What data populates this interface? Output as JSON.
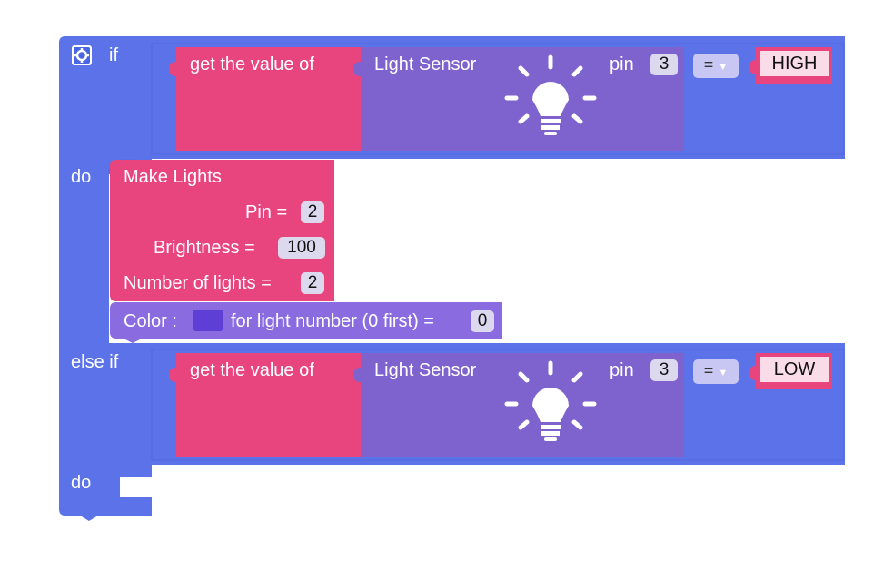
{
  "colors": {
    "control_block": "#5b72e8",
    "sensor_pink": "#e8457e",
    "sensor_purple": "#7e62cd",
    "lights_pink": "#e8457e",
    "color_block": "#8a6ce0",
    "color_swatch": "#5e3fd6",
    "field_bg": "#dcd9ee",
    "string_bg": "#f9dce8"
  },
  "if_block": {
    "if_label": "if",
    "do_label": "do",
    "else_if_label": "else if",
    "do2_label": "do",
    "gear_icon": "gear-icon"
  },
  "condition1": {
    "get_label": "get the value of",
    "sensor_label": "Light Sensor",
    "pin_label": "pin",
    "pin_value": "3",
    "operator": "=",
    "compare_value": "HIGH",
    "sensor_icon": "lightbulb-icon"
  },
  "make_lights": {
    "title": "Make Lights",
    "pin_label": "Pin =",
    "pin_value": "2",
    "brightness_label": "Brightness =",
    "brightness_value": "100",
    "count_label": "Number of lights =",
    "count_value": "2"
  },
  "color_block": {
    "label": "Color :",
    "suffix": "for light number (0 first) =",
    "light_number": "0"
  },
  "condition2": {
    "get_label": "get the value of",
    "sensor_label": "Light Sensor",
    "pin_label": "pin",
    "pin_value": "3",
    "operator": "=",
    "compare_value": "LOW",
    "sensor_icon": "lightbulb-icon"
  }
}
